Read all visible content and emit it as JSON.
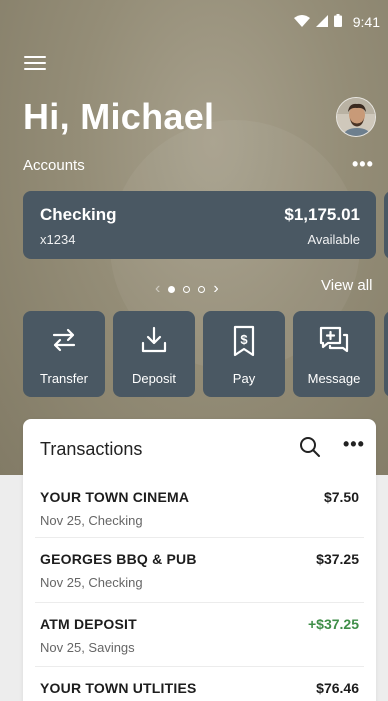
{
  "status_bar": {
    "time": "9:41"
  },
  "greeting": "Hi, Michael",
  "accounts": {
    "label": "Accounts",
    "more": "•••",
    "card": {
      "name": "Checking",
      "number": "x1234",
      "balance": "$1,175.01",
      "balance_label": "Available"
    },
    "view_all": "View all",
    "page_current": 1,
    "page_count": 3
  },
  "actions": [
    {
      "label": "Transfer",
      "icon": "transfer-icon"
    },
    {
      "label": "Deposit",
      "icon": "deposit-icon"
    },
    {
      "label": "Pay",
      "icon": "pay-bill-icon"
    },
    {
      "label": "Message",
      "icon": "message-icon"
    }
  ],
  "transactions": {
    "title": "Transactions",
    "more": "•••",
    "items": [
      {
        "merchant": "YOUR TOWN CINEMA",
        "meta": "Nov 25, Checking",
        "amount": "$7.50",
        "credit": false
      },
      {
        "merchant": "GEORGES BBQ & PUB",
        "meta": "Nov 25, Checking",
        "amount": "$37.25",
        "credit": false
      },
      {
        "merchant": "ATM DEPOSIT",
        "meta": "Nov 25, Savings",
        "amount": "+$37.25",
        "credit": true
      },
      {
        "merchant": "YOUR TOWN UTLITIES",
        "meta": "",
        "amount": "$76.46",
        "credit": false
      }
    ]
  },
  "colors": {
    "card": "#4a5863",
    "credit": "#3f8e48",
    "hero": "#948d77"
  }
}
